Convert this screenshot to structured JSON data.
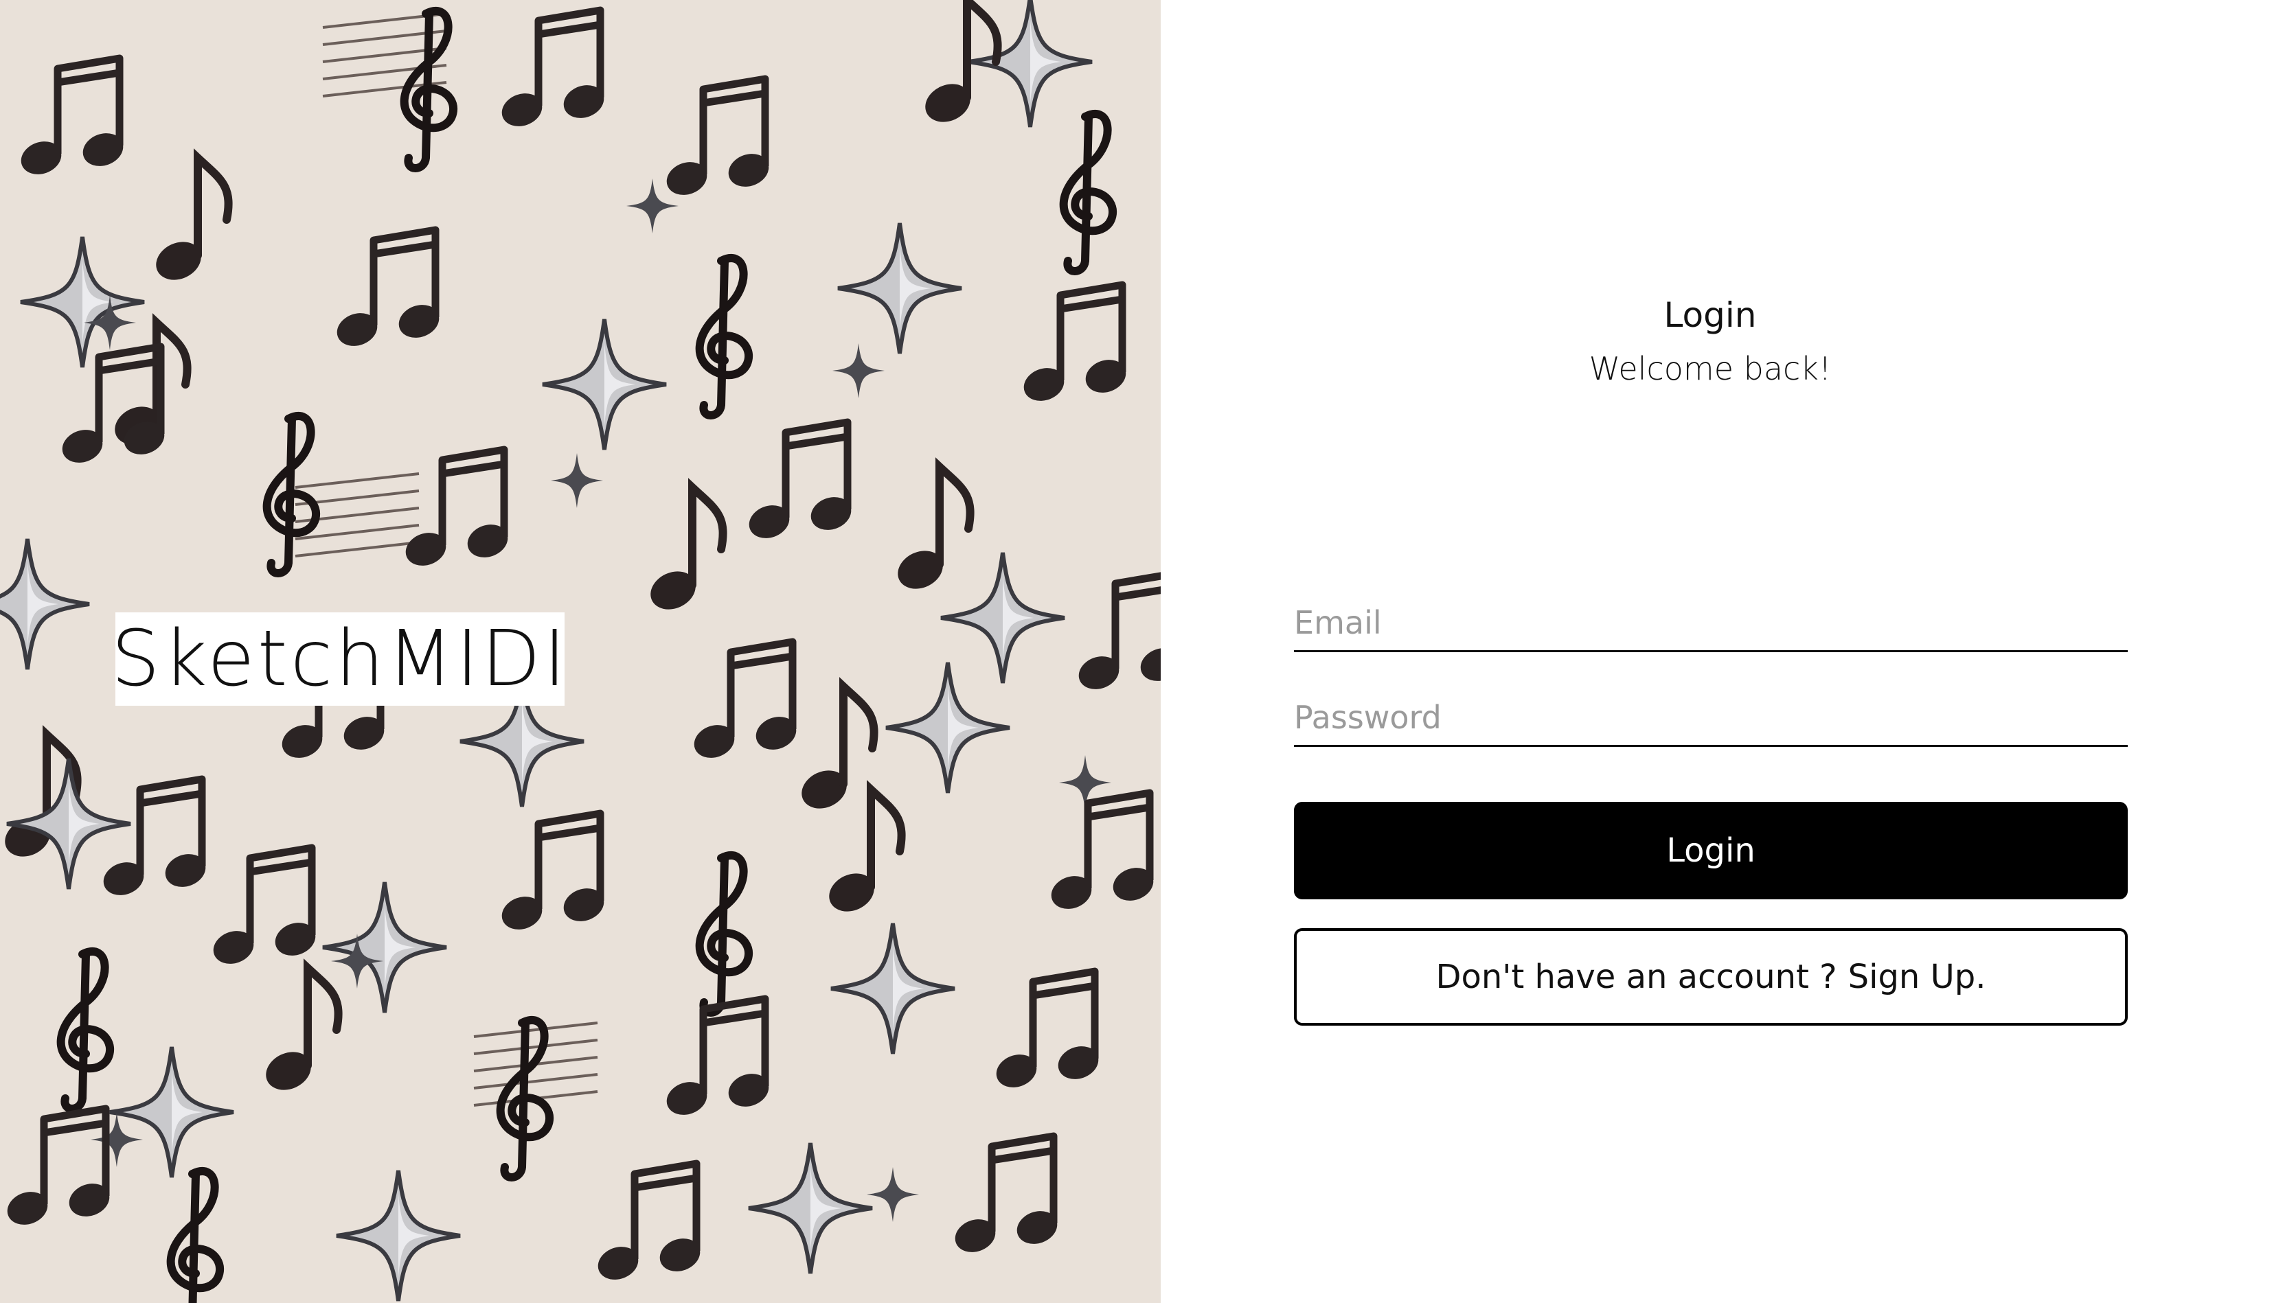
{
  "brand": {
    "name": "SketchMIDI"
  },
  "login": {
    "title": "Login",
    "subtitle": "Welcome back!",
    "email_placeholder": "Email",
    "password_placeholder": "Password",
    "submit_label": "Login",
    "signup_prompt": "Don't have an account ?",
    "signup_link": "Sign Up."
  },
  "colors": {
    "art_background": "#e9e1d9",
    "primary_button": "#000000",
    "primary_text": "#ffffff"
  },
  "icons": [
    "treble-clef-icon",
    "eighth-note-icon",
    "beamed-notes-icon",
    "sparkle-star-icon"
  ]
}
